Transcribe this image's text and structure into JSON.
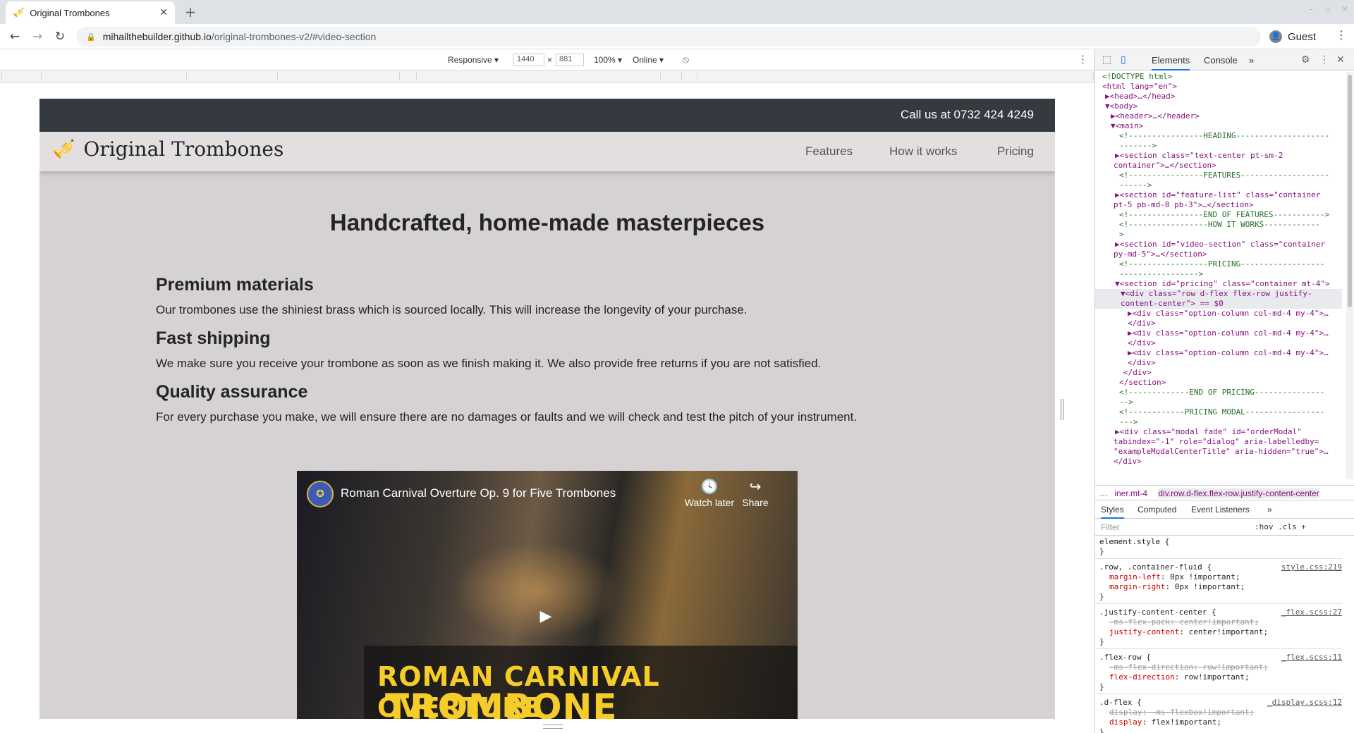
{
  "browser": {
    "tab_title": "Original Trombones",
    "tab_close": "✕",
    "new_tab": "+",
    "url_host": "mihailthebuilder.github.io",
    "url_path": "/original-trombones-v2/#video-section",
    "profile_name": "Guest"
  },
  "device_toolbar": {
    "mode": "Responsive ▾",
    "width": "1440",
    "times": "×",
    "height": "881",
    "zoom": "100% ▾",
    "network": "Online ▾"
  },
  "site": {
    "call_text": "Call us at 0732 424 4249",
    "logo_text": "Original Trombones",
    "nav": [
      "Features",
      "How it works",
      "Pricing"
    ],
    "heading": "Handcrafted, home-made masterpieces",
    "features": [
      {
        "title": "Premium materials",
        "text": "Our trombones use the shiniest brass which is sourced locally. This will increase the longevity of your purchase."
      },
      {
        "title": "Fast shipping",
        "text": "We make sure you receive your trombone as soon as we finish making it. We also provide free returns if you are not satisfied."
      },
      {
        "title": "Quality assurance",
        "text": "For every purchase you make, we will ensure there are no damages or faults and we will check and test the pitch of your instrument."
      }
    ],
    "video": {
      "title": "Roman Carnival Overture Op. 9 for Five Trombones",
      "watch_later": "Watch later",
      "share": "Share",
      "overlay_line1": "ROMAN CARNIVAL OVERTURE",
      "overlay_line2": "TROMBONE QUINTET"
    }
  },
  "devtools": {
    "tabs": [
      "Elements",
      "Console",
      "»"
    ],
    "dom_lines": [
      "<!DOCTYPE html>",
      "<html lang=\"en\">",
      "▶<head>…</head>",
      "▼<body>",
      "▶<header>…</header>",
      "▼<main>",
      "<!----------------HEADING--------------------",
      "------->",
      "▶<section class=\"text-center pt-sm-2",
      "container\">…</section>",
      "<!----------------FEATURES-------------------",
      "------>",
      "▶<section id=\"feature-list\" class=\"container",
      "pt-5 pb-md-0 pb-3\">…</section>",
      "<!----------------END OF FEATURES----------->",
      "<!-----------------HOW IT WORKS------------",
      ">",
      "▶<section id=\"video-section\" class=\"container",
      "py-md-5\">…</section>",
      "<!-----------------PRICING------------------",
      "----------------->",
      "▼<section id=\"pricing\" class=\"container mt-4\">",
      "▼<div class=\"row d-flex flex-row justify-",
      "content-center\"> == $0",
      "▶<div class=\"option-column col-md-4 my-4\">…",
      "</div>",
      "▶<div class=\"option-column col-md-4 my-4\">…",
      "</div>",
      "▶<div class=\"option-column col-md-4 my-4\">…",
      "</div>",
      "</div>",
      "</section>",
      "<!-------------END OF PRICING---------------",
      "-->",
      "<!------------PRICING MODAL-----------------",
      "--->",
      "▶<div class=\"modal fade\" id=\"orderModal\"",
      "tabindex=\"-1\" role=\"dialog\" aria-labelledby=",
      "\"exampleModalCenterTitle\" aria-hidden=\"true\">…",
      "</div>"
    ],
    "breadcrumb_1": "iner.mt-4",
    "breadcrumb_2": "div.row.d-flex.flex-row.justify-content-center",
    "breadcrumb_more": "…",
    "style_tabs": [
      "Styles",
      "Computed",
      "Event Listeners",
      "»"
    ],
    "filter_placeholder": "Filter",
    "filter_hov": ":hov .cls +",
    "rules": [
      {
        "sel": "element.style {",
        "decls": [],
        "src": ""
      },
      {
        "sel": ".row, .container-fluid {",
        "decls": [
          "margin-left: 0px !important;",
          "margin-right: 0px !important;"
        ],
        "src": "style.css:219"
      },
      {
        "sel": ".justify-content-center {",
        "decls": [
          "-ms-flex-pack: center!important;",
          "justify-content: center!important;"
        ],
        "src": "_flex.scss:27"
      },
      {
        "sel": ".flex-row {",
        "decls": [
          "-ms-flex-direction: row!important;",
          "flex-direction: row!important;"
        ],
        "src": "_flex.scss:11"
      },
      {
        "sel": ".d-flex {",
        "decls": [
          "display: -ms-flexbox!important;",
          "display: flex!important;"
        ],
        "src": "_display.scss:12"
      }
    ]
  }
}
